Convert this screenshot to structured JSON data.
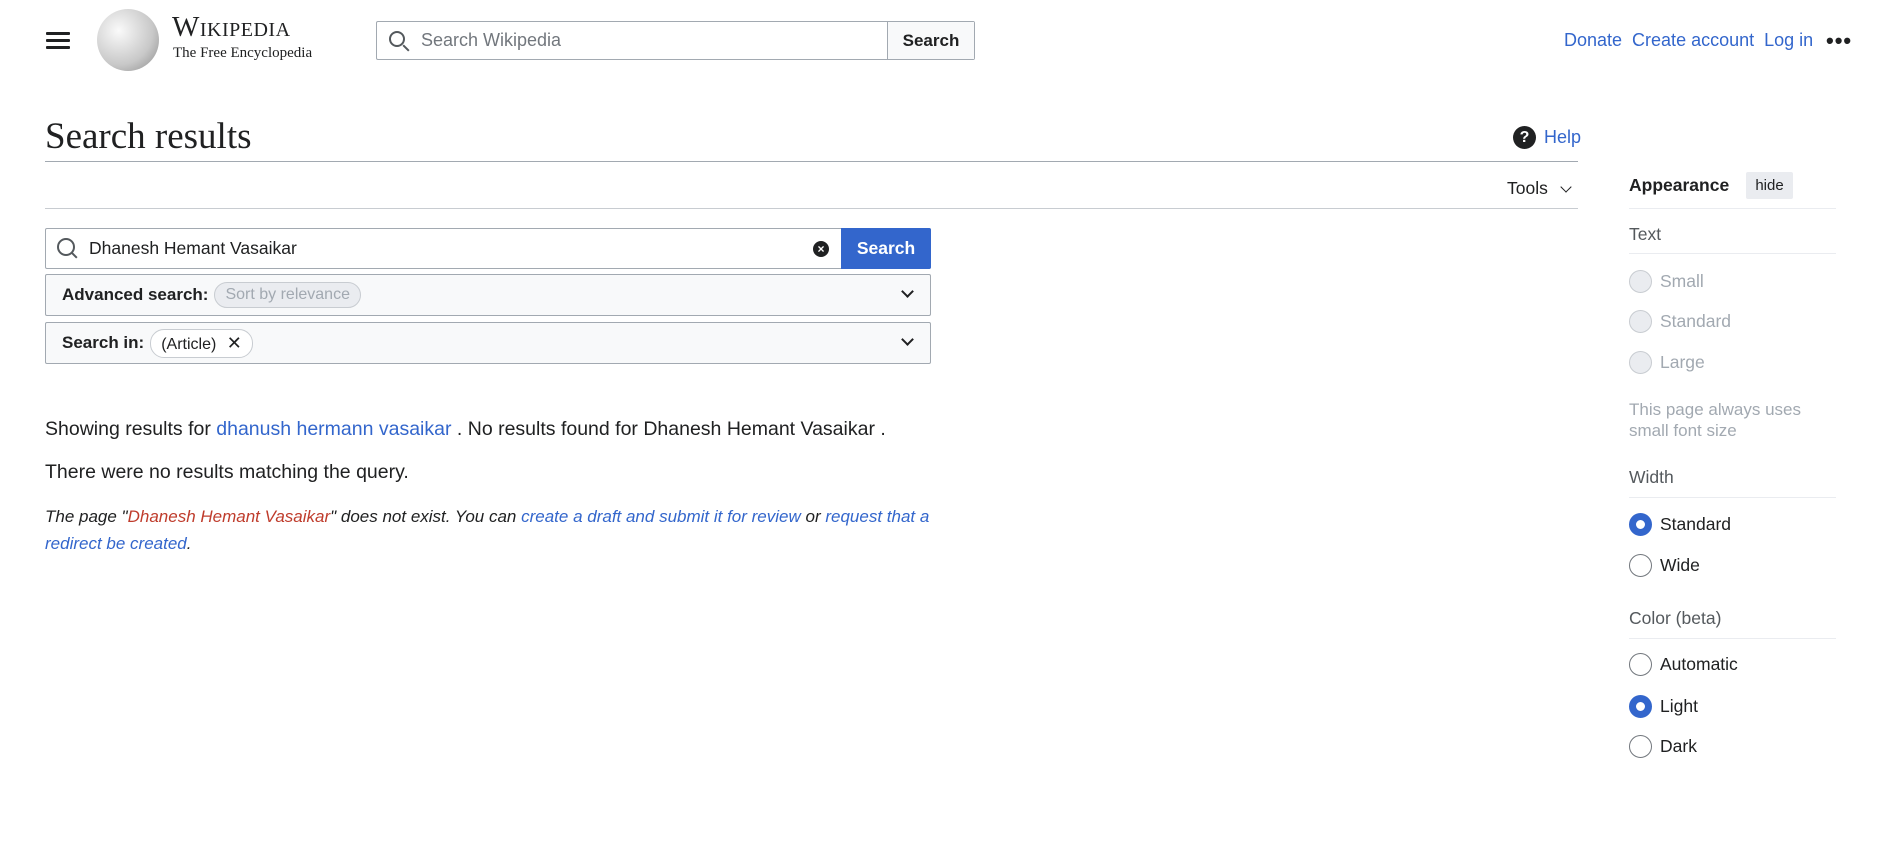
{
  "header": {
    "logo_title": "Wikipedia",
    "logo_tagline": "The Free Encyclopedia",
    "search_placeholder": "Search Wikipedia",
    "search_button": "Search",
    "links": [
      "Donate",
      "Create account",
      "Log in"
    ]
  },
  "page": {
    "title": "Search results",
    "help": "Help",
    "tools": "Tools"
  },
  "search": {
    "query": "Dhanesh Hemant Vasaikar",
    "button": "Search",
    "advanced_label": "Advanced search:",
    "advanced_chip": "Sort by relevance",
    "search_in_label": "Search in:",
    "search_in_chip": "(Article)"
  },
  "results": {
    "showing_prefix": "Showing results for",
    "suggestion": "dhanush hermann vasaikar",
    "no_results_prefix": ". No results found for",
    "original_query": "Dhanesh Hemant Vasaikar",
    "suffix": ".",
    "none": "There were no results matching the query.",
    "page_prefix": "The page \"",
    "page_name": "Dhanesh Hemant Vasaikar",
    "page_mid": "\" does not exist. You can ",
    "draft_link": "create a draft and submit it for review",
    "or": " or ",
    "redirect_link": "request that a redirect be created",
    "end": "."
  },
  "appearance": {
    "title": "Appearance",
    "hide": "hide",
    "text_heading": "Text",
    "text_options": [
      "Small",
      "Standard",
      "Large"
    ],
    "note": "This page always uses small font size",
    "width_heading": "Width",
    "width_options": [
      "Standard",
      "Wide"
    ],
    "width_selected": "Standard",
    "color_heading": "Color (beta)",
    "color_options": [
      "Automatic",
      "Light",
      "Dark"
    ],
    "color_selected": "Light"
  },
  "colors": {
    "link": "#3366cc",
    "redlink": "#bf3c2c"
  }
}
